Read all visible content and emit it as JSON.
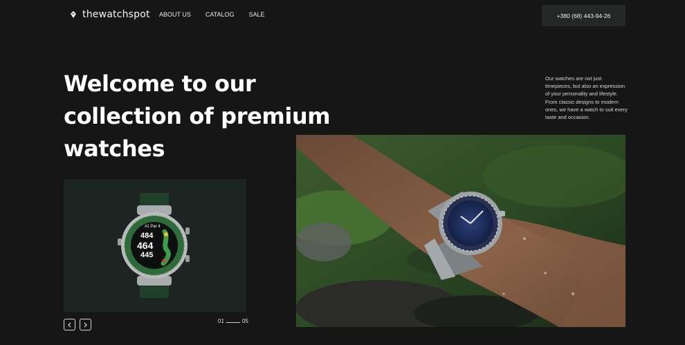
{
  "header": {
    "logo_text": "thewatchspot",
    "nav": [
      "ABOUT US",
      "CATALOG",
      "SALE"
    ],
    "phone": "+380 (68) 443-94-26"
  },
  "hero": {
    "title": "Welcome to our collection of premium watches",
    "description": "Our watches are not just timepieces, but also an expression of your personality and lifestyle. From classic designs to modern ones, we have a watch to suit every taste and occasion."
  },
  "slider": {
    "current": "01",
    "total": "05",
    "watch_face": {
      "hole": "#1 Par 4",
      "values": [
        "484",
        "464",
        "445"
      ]
    }
  },
  "colors": {
    "background": "#161616",
    "card_background": "#1d2523",
    "phone_button": "#232826",
    "bezel_green": "#2f6b3a"
  }
}
